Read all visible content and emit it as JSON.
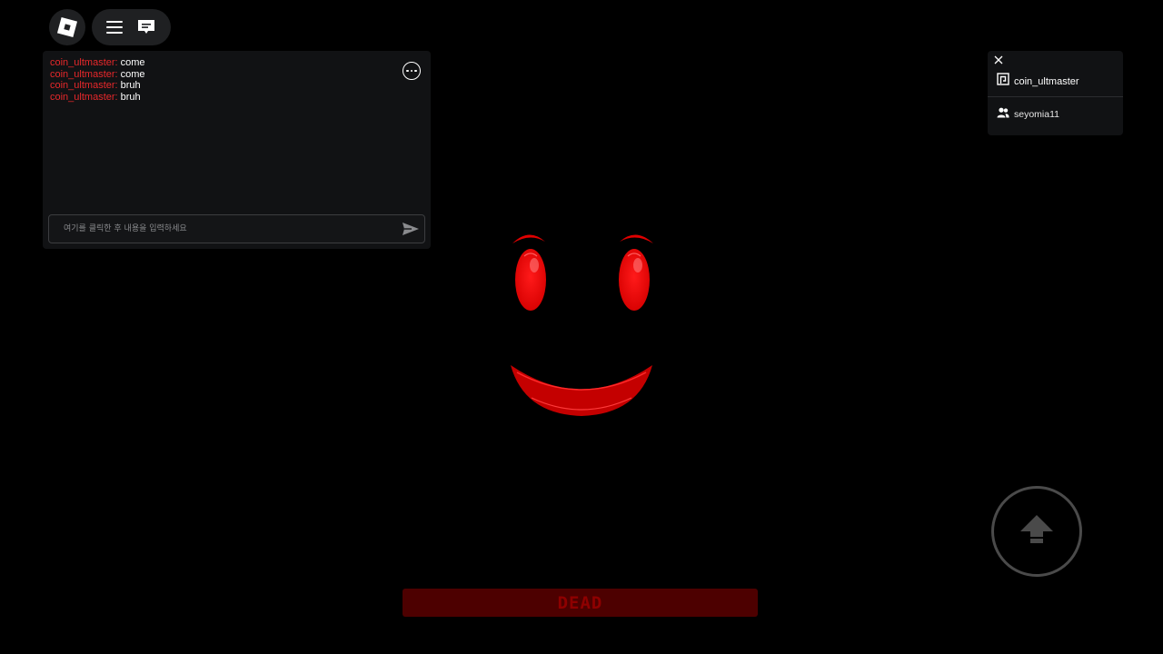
{
  "topbar": {
    "icons": [
      "roblox-logo-icon",
      "menu-icon",
      "chat-icon"
    ]
  },
  "chat": {
    "messages": [
      {
        "user": "coin_ultmaster:",
        "text": "come"
      },
      {
        "user": "coin_ultmaster:",
        "text": "come"
      },
      {
        "user": "coin_ultmaster:",
        "text": "bruh"
      },
      {
        "user": "coin_ultmaster:",
        "text": "bruh"
      }
    ],
    "input_placeholder": "여기를 클릭한 후 내용을 입력하세요",
    "username_color": "#e8282b"
  },
  "player_list": {
    "local_player": "coin_ultmaster",
    "other_player": "seyomia11"
  },
  "status_bar": {
    "label": "DEAD",
    "bar_color": "#4d0000",
    "text_color": "#8e0000"
  },
  "face": {
    "color": "#ff0000"
  }
}
